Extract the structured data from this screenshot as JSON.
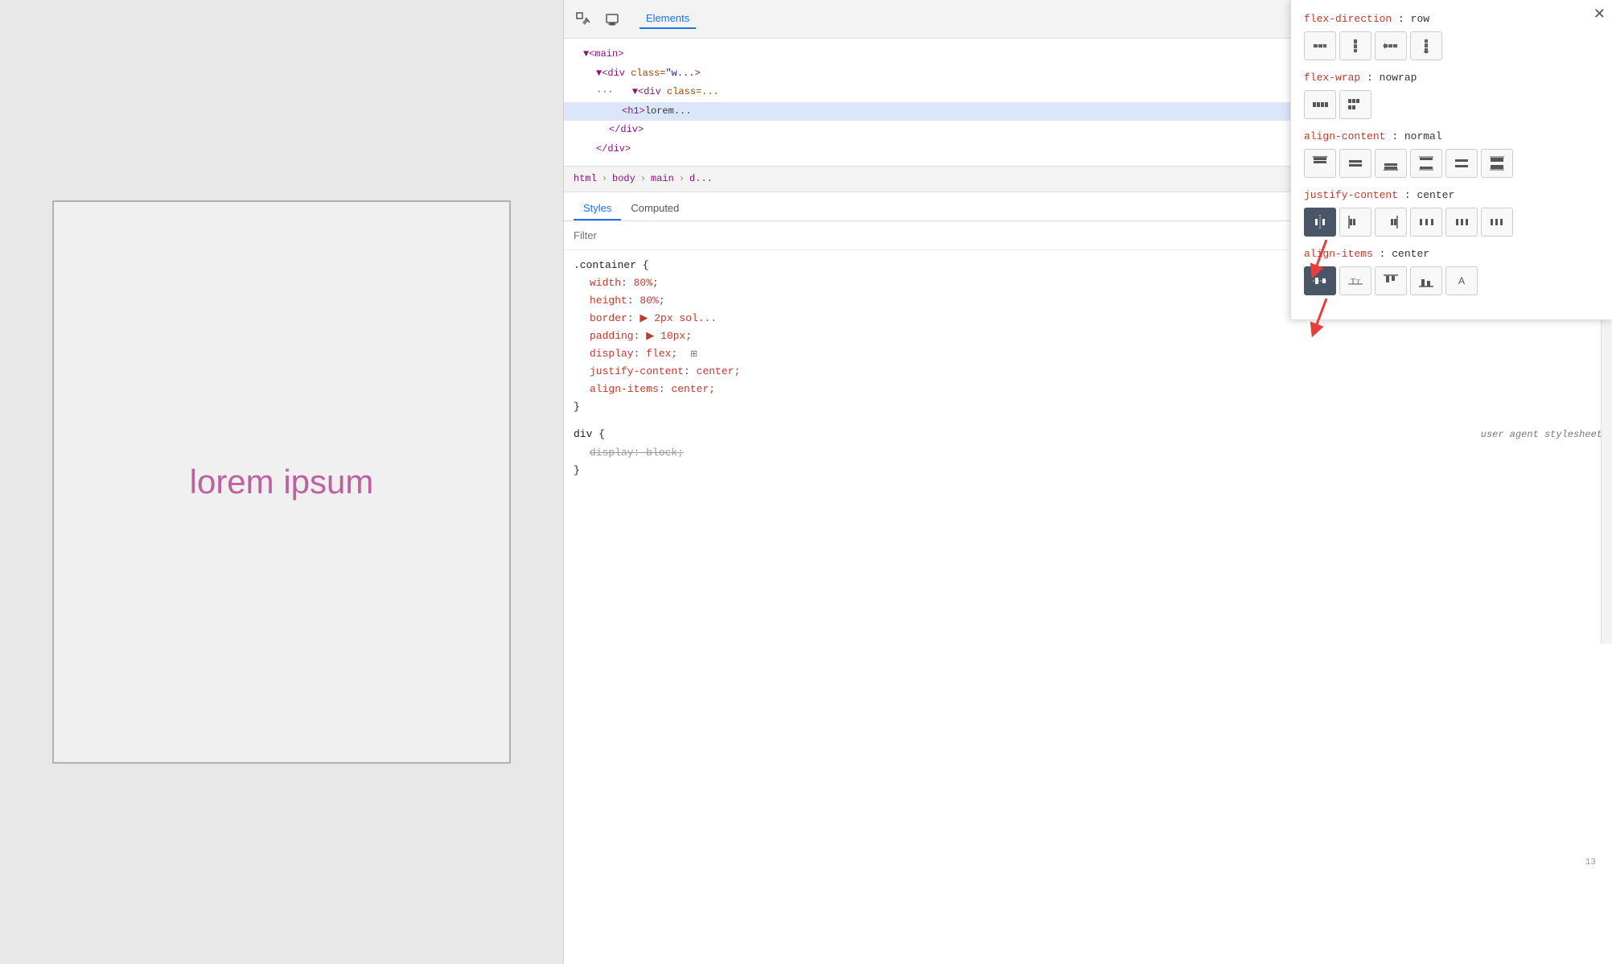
{
  "viewport": {
    "lorem_text": "lorem ipsum"
  },
  "devtools": {
    "toolbar": {
      "inspect_icon": "⊡",
      "device_icon": "⬜",
      "tab_label": "Elements"
    },
    "elements_tree": {
      "lines": [
        {
          "indent": 1,
          "content": "▼<main>"
        },
        {
          "indent": 2,
          "content": "▼<div class=\"w..."
        },
        {
          "indent": 3,
          "content": "▼<div class=..."
        },
        {
          "indent": 4,
          "content": "<h1>lorem..."
        },
        {
          "indent": 3,
          "content": "</div>"
        },
        {
          "indent": 2,
          "content": "</div>"
        }
      ]
    },
    "breadcrumb": {
      "items": [
        "html",
        "body",
        "main",
        "d..."
      ]
    },
    "panels": {
      "styles_label": "Styles",
      "computed_label": "Computed"
    },
    "filter": {
      "placeholder": "Filter"
    },
    "css_rules": {
      "container_rule": {
        "selector": ".container {",
        "properties": [
          {
            "name": "width",
            "value": "80%",
            "strikethrough": false
          },
          {
            "name": "height",
            "value": "80%",
            "strikethrough": false
          },
          {
            "name": "border",
            "value": "▶ 2px sol...",
            "strikethrough": false
          },
          {
            "name": "padding",
            "value": "▶ 10px;",
            "strikethrough": false
          },
          {
            "name": "display",
            "value": "flex;",
            "strikethrough": false
          },
          {
            "name": "justify-content",
            "value": "center;",
            "strikethrough": false
          },
          {
            "name": "align-items",
            "value": "center;",
            "strikethrough": false
          }
        ],
        "close": "}"
      },
      "div_rule": {
        "selector": "div {",
        "comment": "user agent stylesheet",
        "properties": [
          {
            "name": "display",
            "value": "block;",
            "strikethrough": true
          }
        ],
        "close": "}"
      }
    },
    "flexbox_editor": {
      "flex_direction": {
        "label": "flex-direction",
        "value": "row",
        "buttons": [
          "row",
          "column",
          "row-reverse",
          "column-reverse"
        ]
      },
      "flex_wrap": {
        "label": "flex-wrap",
        "value": "nowrap",
        "buttons": [
          "nowrap",
          "wrap"
        ]
      },
      "align_content": {
        "label": "align-content",
        "value": "normal",
        "buttons": [
          "flex-start",
          "center",
          "flex-end",
          "space-between",
          "space-around",
          "stretch"
        ]
      },
      "justify_content": {
        "label": "justify-content",
        "value": "center",
        "buttons": [
          "flex-start",
          "center",
          "flex-end",
          "space-between",
          "space-around",
          "space-evenly"
        ],
        "active_index": 0
      },
      "align_items": {
        "label": "align-items",
        "value": "center",
        "buttons": [
          "center",
          "baseline",
          "flex-start",
          "flex-end",
          "auto"
        ],
        "active_index": 0
      }
    }
  }
}
